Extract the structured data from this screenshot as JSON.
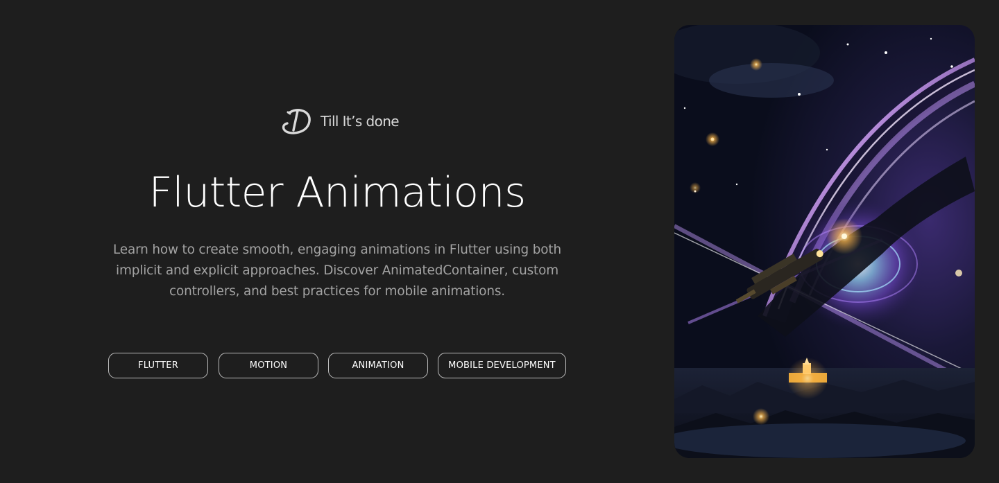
{
  "brand": {
    "name": "Till It’s done",
    "logo_icon": "td-monogram-icon"
  },
  "hero": {
    "title": "Flutter Animations",
    "description": "Learn how to create smooth, engaging animations in Flutter using both implicit and explicit approaches. Discover AnimatedContainer, custom controllers, and best practices for mobile animations."
  },
  "tags": [
    {
      "label": "FLUTTER"
    },
    {
      "label": "MOTION"
    },
    {
      "label": "ANIMATION"
    },
    {
      "label": "MOBILE DEVELOPMENT"
    }
  ],
  "image": {
    "subject": "space-illustration-icon"
  },
  "colors": {
    "background": "#1e1e1e",
    "title": "#ffffff",
    "description": "#a3a3a3",
    "tag_border": "#bdbdbd",
    "accent_purple": "#b07cff",
    "accent_gold": "#ffc24a"
  }
}
